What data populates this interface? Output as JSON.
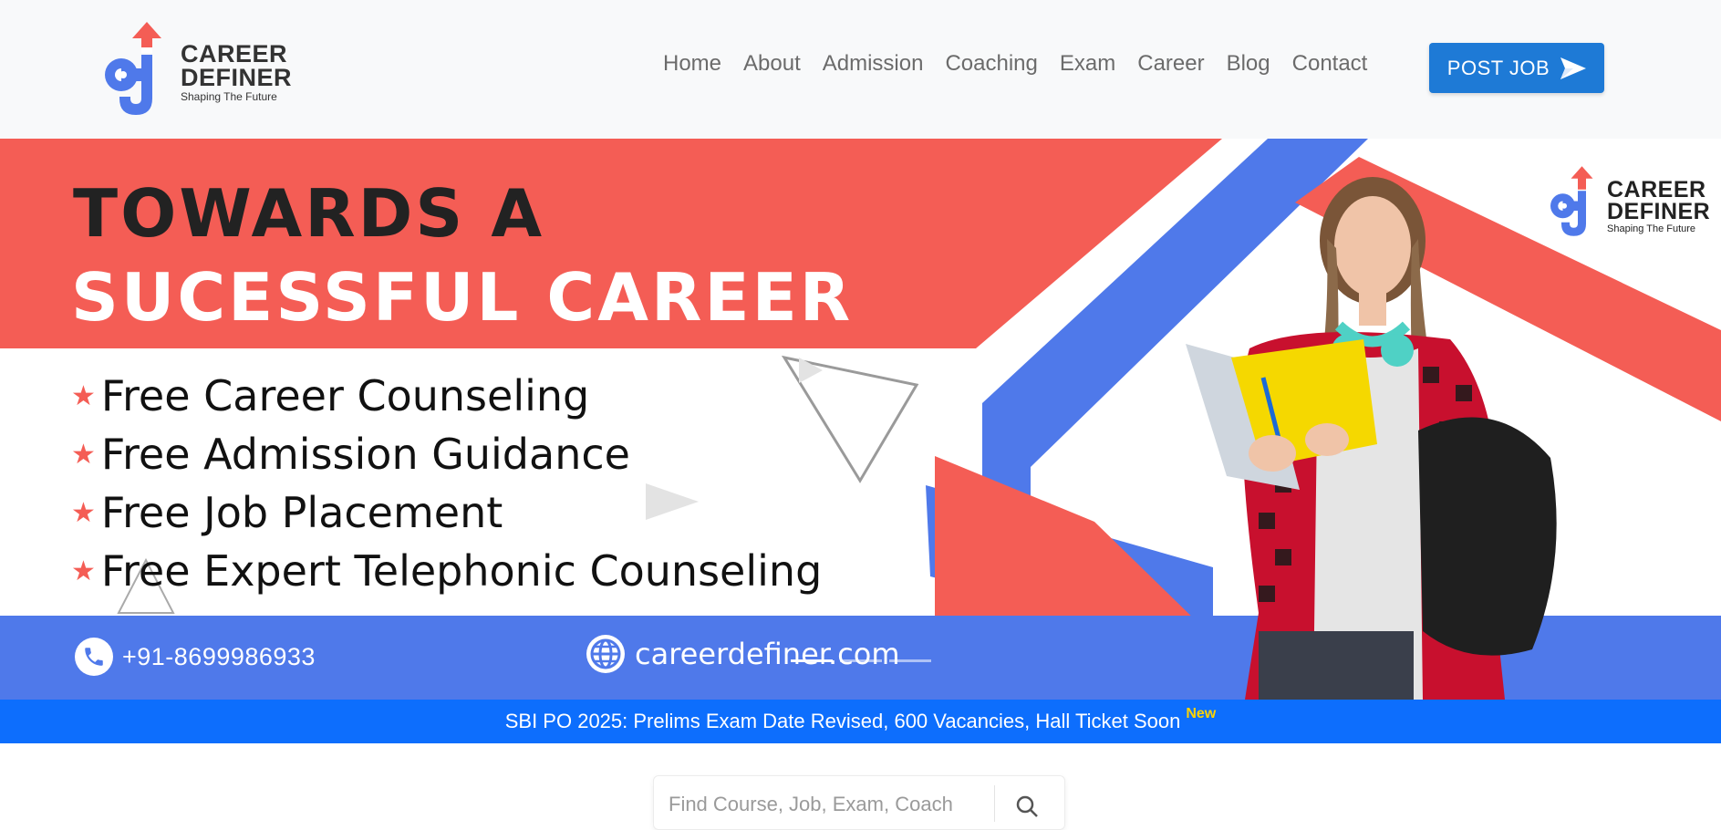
{
  "header": {
    "logo": {
      "line1": "CAREER",
      "line2": "DEFINER",
      "tagline": "Shaping The Future"
    },
    "nav": [
      "Home",
      "About",
      "Admission",
      "Coaching",
      "Exam",
      "Career",
      "Blog",
      "Contact"
    ],
    "post_job_label": "POST JOB"
  },
  "banner": {
    "headline_line1": "TOWARDS A",
    "headline_line2": "SUCESSFUL CAREER",
    "features": [
      "Free Career Counseling",
      "Free Admission Guidance",
      "Free Job Placement",
      "Free Expert Telephonic Counseling"
    ],
    "phone": "+91-8699986933",
    "website": "careerdefiner.com",
    "logo": {
      "line1": "CAREER",
      "line2": "DEFINER",
      "tagline": "Shaping The Future"
    },
    "slides": 3,
    "active_slide": 1
  },
  "ticker": {
    "text": "SBI PO 2025: Prelims Exam Date Revised, 600 Vacancies, Hall Ticket Soon",
    "badge": "New"
  },
  "search": {
    "placeholder": "Find Course, Job, Exam, Coach"
  },
  "colors": {
    "brand_red": "#f45d55",
    "brand_blue": "#4f79ea",
    "button_blue": "#1e7ad6",
    "ticker_blue": "#0d6efd",
    "badge_yellow": "#ffd400"
  },
  "icons": [
    "logo-icon",
    "send-icon",
    "star-icon",
    "phone-icon",
    "globe-icon",
    "search-icon"
  ]
}
